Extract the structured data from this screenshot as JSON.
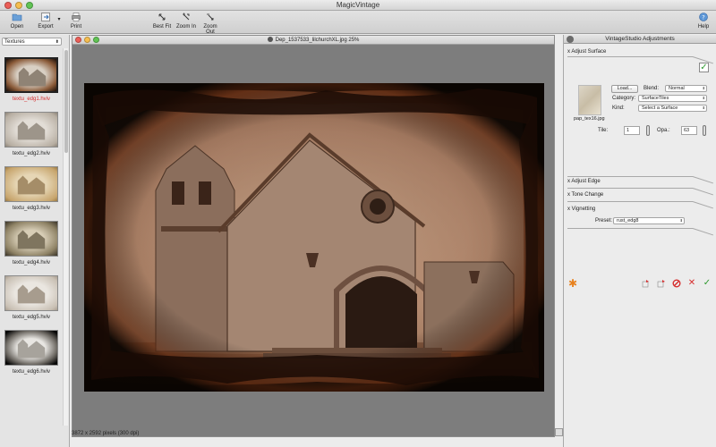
{
  "app": {
    "title": "MagicVintage"
  },
  "toolbar": {
    "open": "Open",
    "export": "Export",
    "print": "Print",
    "best_fit": "Best Fit",
    "zoom_in": "Zoom In",
    "zoom_out": "Zoom Out",
    "help": "Help"
  },
  "textures": {
    "select_value": "Textures",
    "items": [
      {
        "label": "textu_edg1.hviv",
        "selected": true
      },
      {
        "label": "textu_edg2.hviv",
        "selected": false
      },
      {
        "label": "textu_edg3.hviv",
        "selected": false
      },
      {
        "label": "textu_edg4.hviv",
        "selected": false
      },
      {
        "label": "textu_edg5.hviv",
        "selected": false
      },
      {
        "label": "textu_edg6.hviv",
        "selected": false
      }
    ]
  },
  "document": {
    "title": "Dep_1537533_lilchurchXL.jpg 25%",
    "status": "3872 x 2592 pixels (300 dpi)"
  },
  "adjust": {
    "panel_title": "VintageStudio Adjustments",
    "surface_header": "x Adjust Surface",
    "surface_enabled": true,
    "swatch_label": "pap_tex16.jpg",
    "load_label": "Load...",
    "blend_label": "Blend:",
    "blend_value": "Normal",
    "category_label": "Category:",
    "category_value": "SurfaceTiles",
    "kind_label": "Kind:",
    "kind_value": "Select a Surface",
    "tile_label": "Tile:",
    "tile_value": "1",
    "opa_label": "Opa.:",
    "opa_value": "63",
    "edge_header": "x Adjust Edge",
    "tone_header": "x Tone Change",
    "vignette_header": "x Vignetting",
    "preset_label": "Preset:",
    "preset_value": "rust_edg8"
  },
  "colors": {
    "accent_check": "#2f9a2f",
    "cancel_red": "#d62d2d",
    "selected_label": "#d62d2d",
    "asterisk_orange": "#e8821e"
  }
}
